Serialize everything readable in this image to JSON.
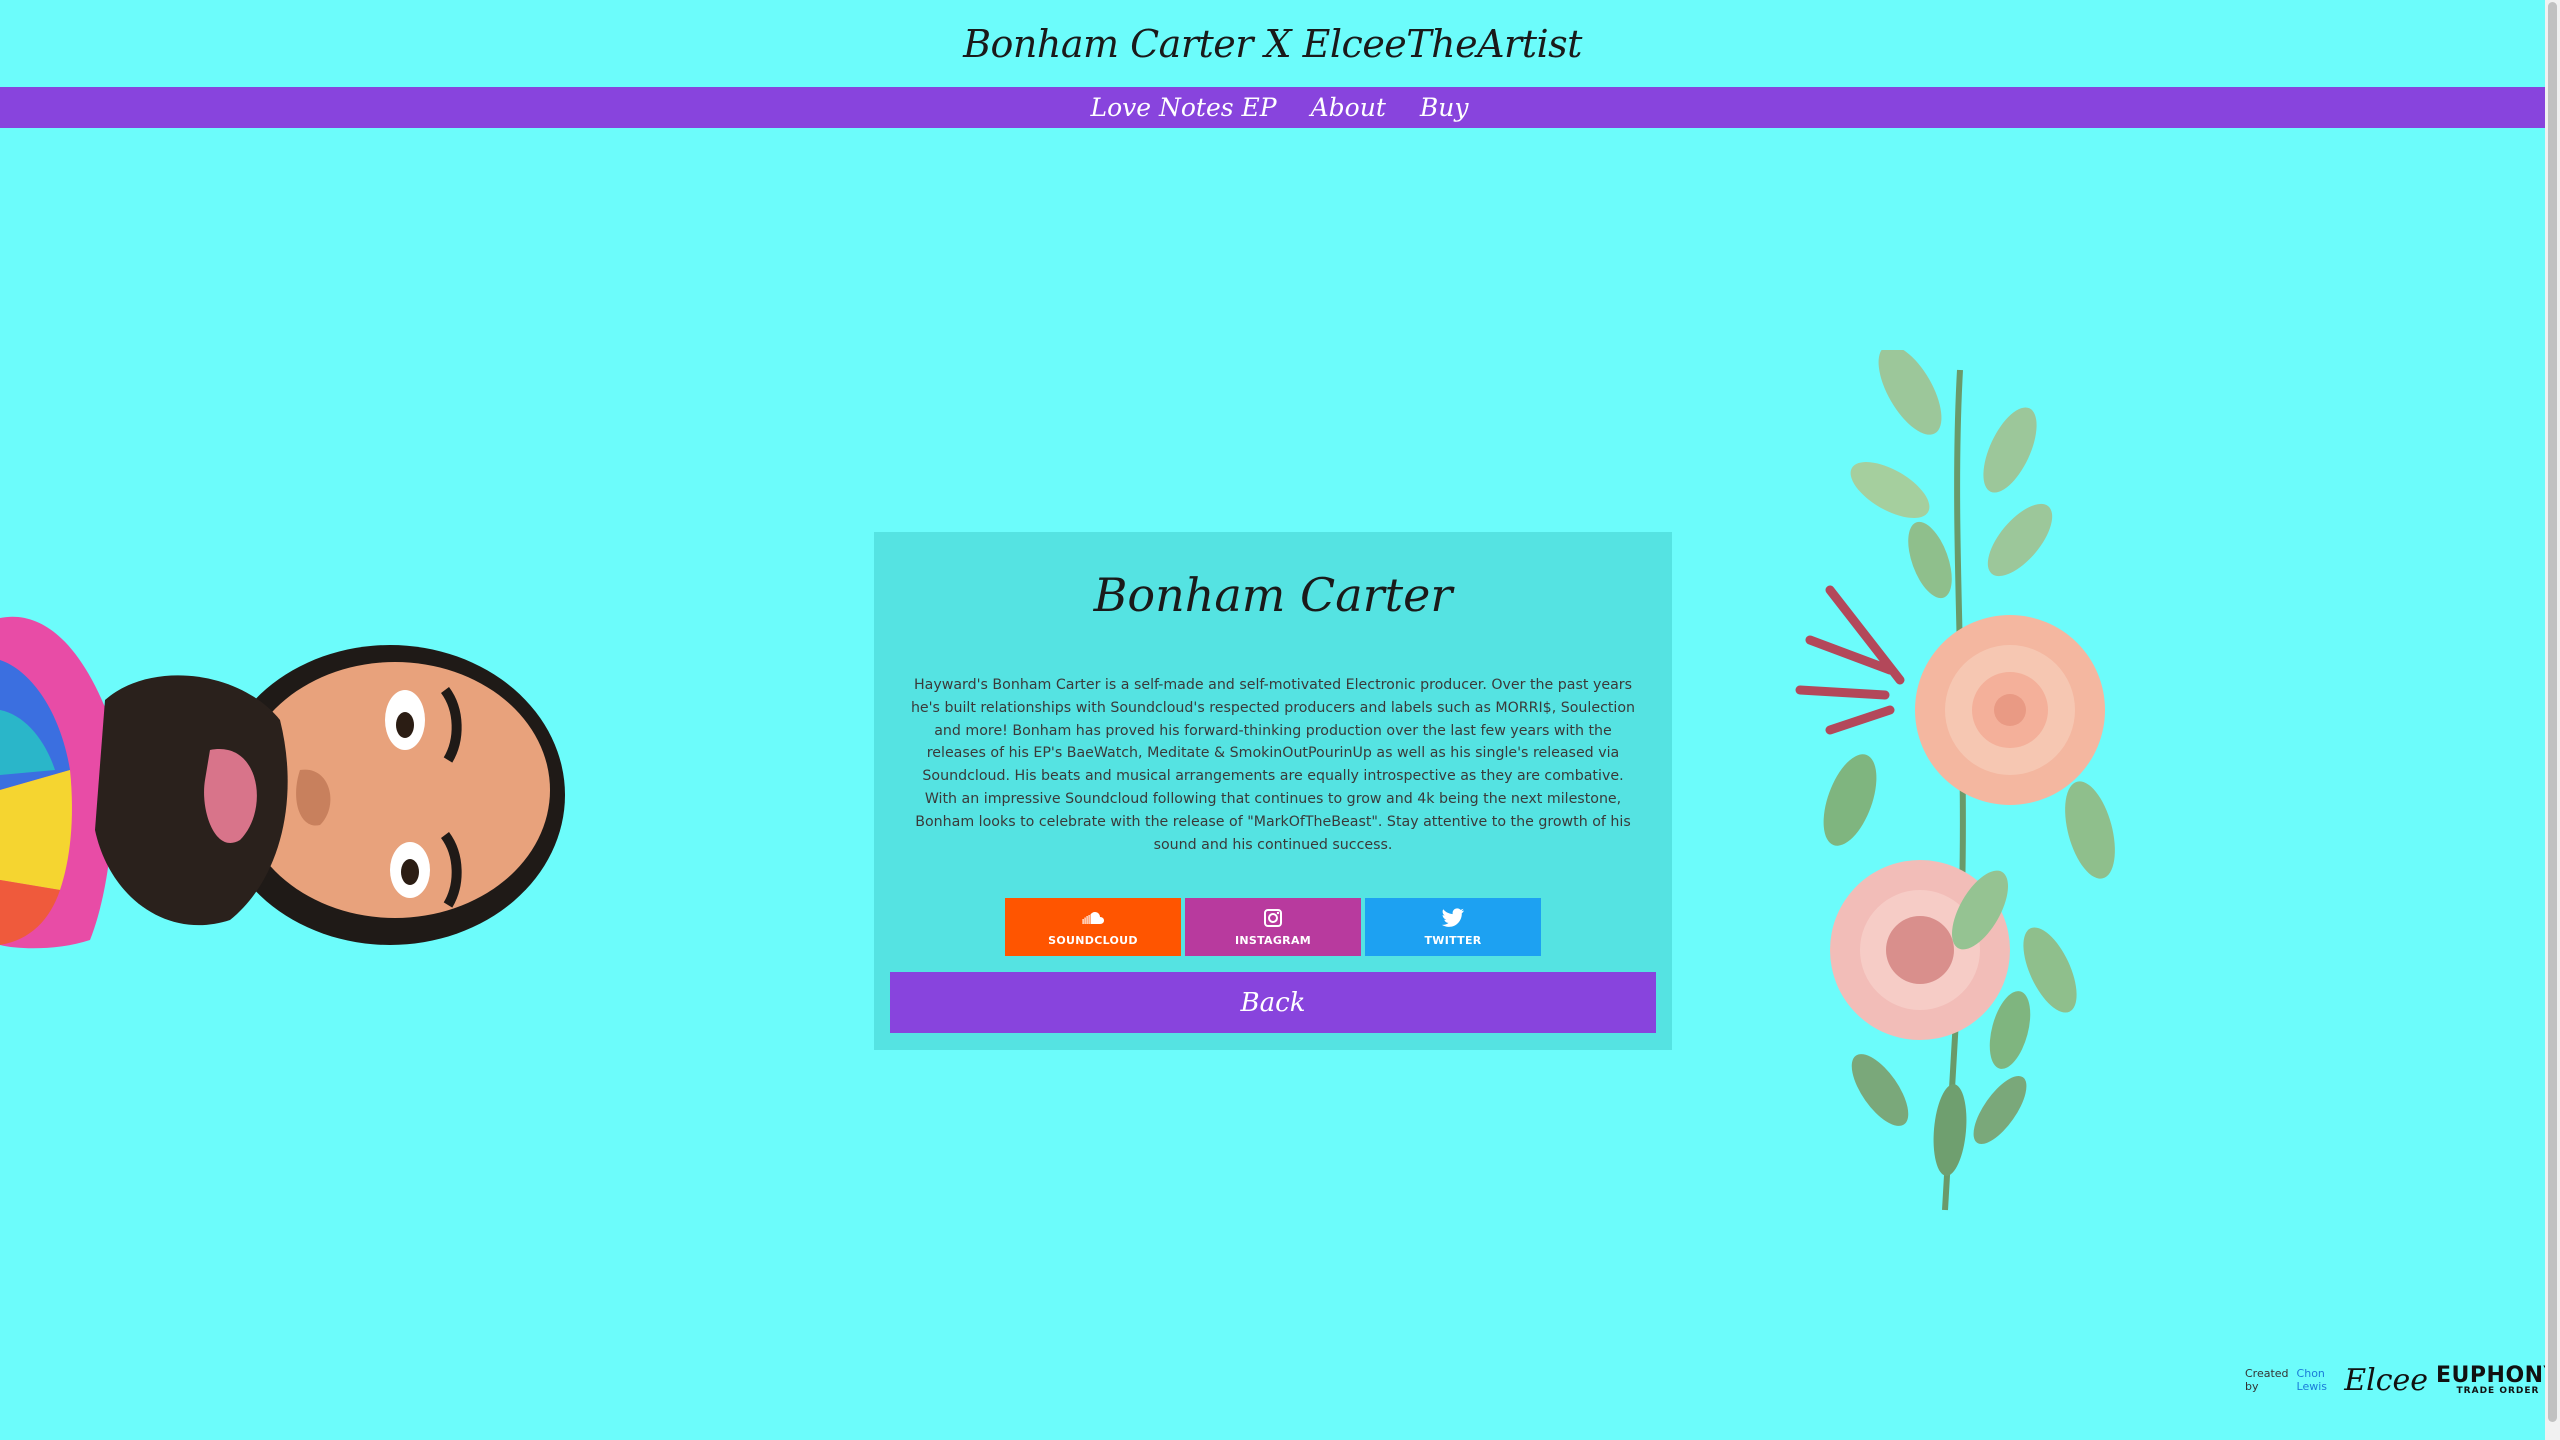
{
  "header": {
    "title": "Bonham Carter X ElceeTheArtist"
  },
  "nav": {
    "items": [
      {
        "label": "Love Notes EP"
      },
      {
        "label": "About"
      },
      {
        "label": "Buy"
      }
    ]
  },
  "card": {
    "title": "Bonham Carter",
    "bio": "Hayward's Bonham Carter is a self-made and self-motivated Electronic producer. Over the past years he's built relationships with Soundcloud's respected producers and labels such as MORRI$, Soulection and more! Bonham has proved his forward-thinking production over the last few years with the releases of his EP's BaeWatch, Meditate & SmokinOutPourinUp as well as his single's released via Soundcloud. His beats and musical arrangements are equally introspective as they are combative. With an impressive Soundcloud following that continues to grow and 4k being the next milestone, Bonham looks to celebrate with the release of \"MarkOfTheBeast\". Stay attentive to the growth of his sound and his continued success.",
    "social": [
      {
        "label": "SOUNDCLOUD",
        "icon": "soundcloud-icon",
        "color": "#ff5500"
      },
      {
        "label": "INSTAGRAM",
        "icon": "instagram-icon",
        "color": "#b83a9e"
      },
      {
        "label": "TWITTER",
        "icon": "twitter-icon",
        "color": "#1da1f2"
      }
    ],
    "back_label": "Back"
  },
  "footer": {
    "created_by": "Created by",
    "author": "Chon Lewis",
    "elcee_logo": "Elcee",
    "euphony_main": "EUPHONY",
    "euphony_sub": "TRADE ORDER"
  },
  "colors": {
    "background": "#6cfcfb",
    "nav": "#8844dd",
    "card": "#55e3e2"
  }
}
